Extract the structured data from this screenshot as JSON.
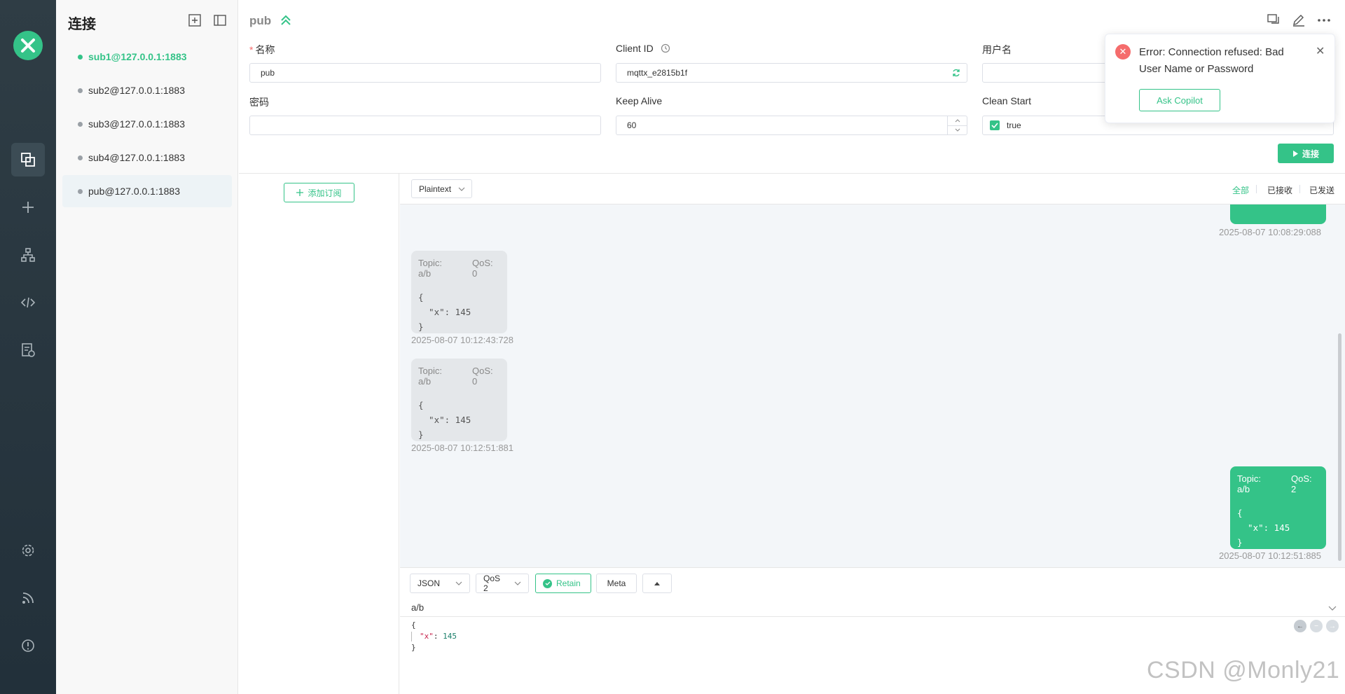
{
  "sidebar": {
    "title": "连接",
    "connections": [
      {
        "label": "sub1@127.0.0.1:1883",
        "online": true,
        "selected": false
      },
      {
        "label": "sub2@127.0.0.1:1883",
        "online": false,
        "selected": false
      },
      {
        "label": "sub3@127.0.0.1:1883",
        "online": false,
        "selected": false
      },
      {
        "label": "sub4@127.0.0.1:1883",
        "online": false,
        "selected": false
      },
      {
        "label": "pub@127.0.0.1:1883",
        "online": false,
        "selected": true
      }
    ]
  },
  "header": {
    "connection_name": "pub"
  },
  "form": {
    "name_label": "名称",
    "name_value": "pub",
    "client_id_label": "Client ID",
    "client_id_value": "mqttx_e2815b1f",
    "username_label": "用户名",
    "username_value": "",
    "password_label": "密码",
    "password_value": "",
    "keepalive_label": "Keep Alive",
    "keepalive_value": "60",
    "clean_start_label": "Clean Start",
    "clean_start_value": "true",
    "connect_label": "连接"
  },
  "subscriptions": {
    "add_label": "添加订阅"
  },
  "messages": {
    "format": "Plaintext",
    "filters": [
      "全部",
      "已接收",
      "已发送"
    ],
    "items": [
      {
        "direction": "sent",
        "partial": true,
        "timestamp": "2025-08-07 10:08:29:088"
      },
      {
        "direction": "recv",
        "topic": "Topic: a/b",
        "qos": "QoS: 0",
        "payload_lines": [
          "{",
          "  \"x\": 145",
          "}"
        ],
        "timestamp": "2025-08-07 10:12:43:728"
      },
      {
        "direction": "recv",
        "topic": "Topic: a/b",
        "qos": "QoS: 0",
        "payload_lines": [
          "{",
          "  \"x\": 145",
          "}"
        ],
        "timestamp": "2025-08-07 10:12:51:881"
      },
      {
        "direction": "sent",
        "topic": "Topic: a/b",
        "qos": "QoS: 2",
        "payload_lines": [
          "{",
          "  \"x\": 145",
          "}"
        ],
        "timestamp": "2025-08-07 10:12:51:885"
      }
    ]
  },
  "publish": {
    "format": "JSON",
    "qos": "QoS 2",
    "retain_label": "Retain",
    "meta_label": "Meta",
    "topic": "a/b",
    "payload": {
      "open": "{",
      "key": "\"x\"",
      "colon": ": ",
      "value": "145",
      "close": "}"
    }
  },
  "toast": {
    "message": "Error: Connection refused: Bad User Name or Password",
    "action_label": "Ask Copilot"
  },
  "watermark": "CSDN @Monly21",
  "colors": {
    "accent": "#34c388",
    "error": "#f56c6c",
    "rail": "#2f3d45"
  }
}
